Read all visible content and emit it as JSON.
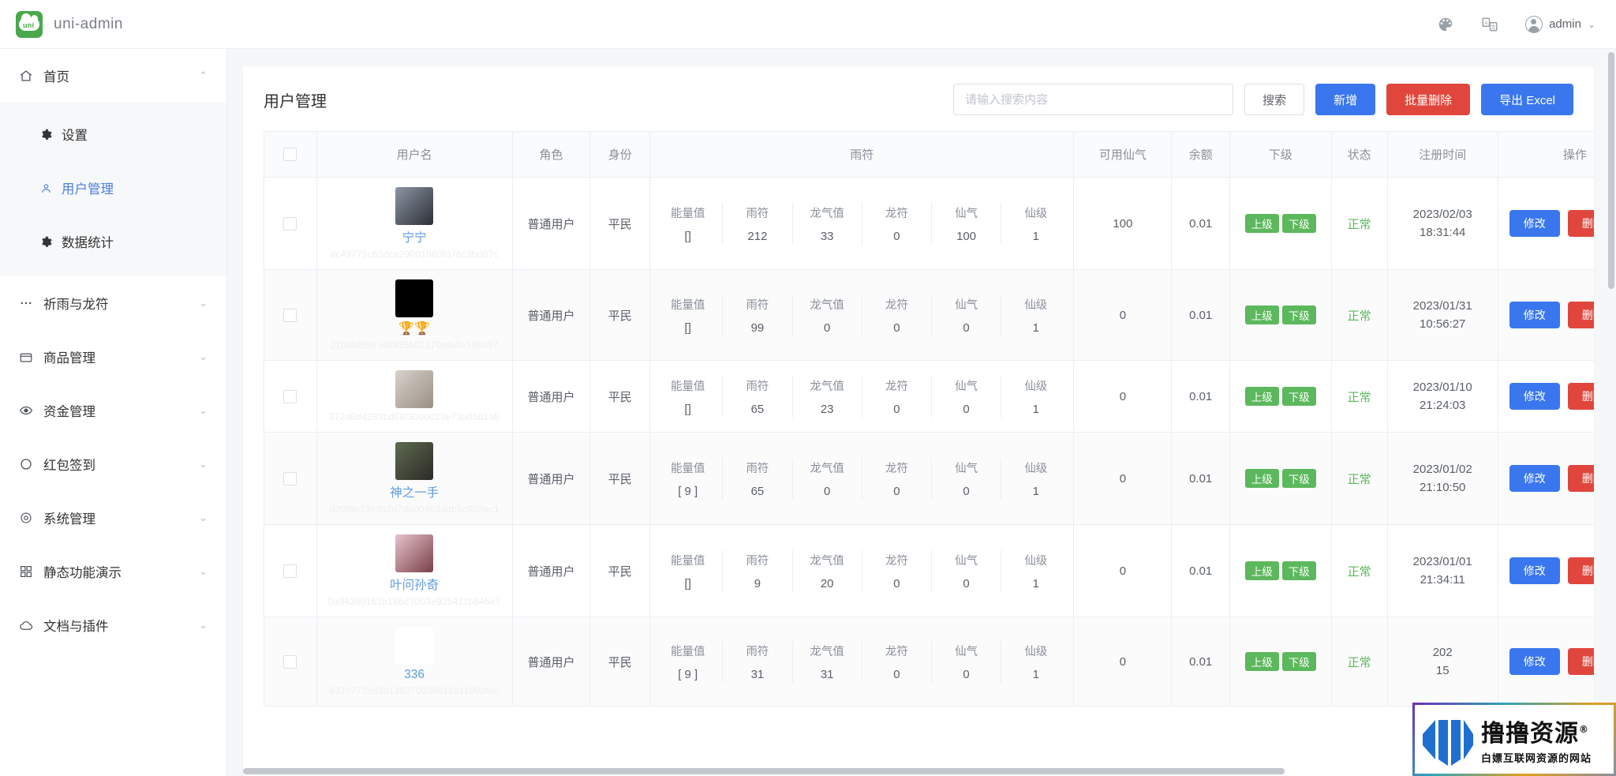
{
  "topbar": {
    "brand_mark": "uni",
    "brand_name": "uni-admin",
    "theme_icon": "palette-icon",
    "language_icon": "language-icon",
    "user_label": "admin",
    "caret": "⌄"
  },
  "sidebar": {
    "items": [
      {
        "label": "首页",
        "icon": "home-icon",
        "arrow": "⌃",
        "expanded": true,
        "children": [
          {
            "label": "设置",
            "icon": "gear-icon",
            "active": false
          },
          {
            "label": "用户管理",
            "icon": "user-icon",
            "active": true
          },
          {
            "label": "数据统计",
            "icon": "gear-icon",
            "active": false
          }
        ]
      },
      {
        "label": "祈雨与龙符",
        "icon": "dots-icon",
        "arrow": "⌄"
      },
      {
        "label": "商品管理",
        "icon": "shop-icon",
        "arrow": "⌄"
      },
      {
        "label": "资金管理",
        "icon": "eye-icon",
        "arrow": "⌄"
      },
      {
        "label": "红包签到",
        "icon": "circle-icon",
        "arrow": "⌄"
      },
      {
        "label": "系统管理",
        "icon": "settings-icon",
        "arrow": "⌄"
      },
      {
        "label": "静态功能演示",
        "icon": "grid-icon",
        "arrow": "⌄"
      },
      {
        "label": "文档与插件",
        "icon": "cloud-icon",
        "arrow": "⌄"
      }
    ]
  },
  "page": {
    "title": "用户管理",
    "search_placeholder": "请输入搜索内容",
    "search_value": "",
    "buttons": {
      "search": "搜索",
      "add": "新增",
      "batch_delete": "批量删除",
      "export": "导出 Excel"
    }
  },
  "table": {
    "columns": {
      "checkbox": "",
      "username": "用户名",
      "role": "角色",
      "identity": "身份",
      "rain": "雨符",
      "available_qi": "可用仙气",
      "balance": "余额",
      "sub": "下级",
      "state": "状态",
      "register_time": "注册时间",
      "action": "操作"
    },
    "rain_sub_columns": [
      "能量值",
      "雨符",
      "龙气值",
      "龙符",
      "仙气",
      "仙级"
    ],
    "row_buttons": {
      "edit": "修改",
      "delete": "删除"
    },
    "tags": {
      "up": "上级",
      "down": "下级"
    },
    "rows": [
      {
        "username": "宁宁",
        "uuid": "dc49771c63dce29001960fd76c3bd07c",
        "avatar_colors": [
          "#8d97a5",
          "#2b2e35"
        ],
        "role": "普通用户",
        "identity": "平民",
        "rain_values": [
          "[]",
          "212",
          "33",
          "0",
          "100",
          "1"
        ],
        "available_qi": "100",
        "balance": "0.01",
        "state": "正常",
        "register_time_date": "2023/02/03",
        "register_time_clock": "18:31:44"
      },
      {
        "username": "🏆🏆",
        "uuid": "21f8dd5b63d8835b01270efa0e196d97",
        "avatar_colors": [
          "#000000",
          "#000000"
        ],
        "role": "普通用户",
        "identity": "平民",
        "rain_values": [
          "[]",
          "99",
          "0",
          "0",
          "0",
          "1"
        ],
        "available_qi": "0",
        "balance": "0.01",
        "state": "正常",
        "register_time_date": "2023/01/31",
        "register_time_clock": "10:56:27"
      },
      {
        "username": "",
        "uuid": "372d8d4283bd66f3000023e73a05b1a8",
        "avatar_colors": [
          "#d8d2cb",
          "#9a8f84"
        ],
        "role": "普通用户",
        "identity": "平民",
        "rain_values": [
          "[]",
          "65",
          "23",
          "0",
          "0",
          "1"
        ],
        "available_qi": "0",
        "balance": "0.01",
        "state": "正常",
        "register_time_date": "2023/01/10",
        "register_time_clock": "21:24:03"
      },
      {
        "username": "神之一手",
        "uuid": "d26f8b7363b2d7da00403ddb5c6b3ec1",
        "avatar_colors": [
          "#5d6b4f",
          "#2d2a28"
        ],
        "role": "普通用户",
        "identity": "平民",
        "rain_values": [
          "[ 9 ]",
          "65",
          "0",
          "0",
          "0",
          "1"
        ],
        "available_qi": "0",
        "balance": "0.01",
        "state": "正常",
        "register_time_date": "2023/01/02",
        "register_time_clock": "21:10:50"
      },
      {
        "username": "叶问孙奇",
        "uuid": "0a94390163b18bd3003e925411b846e7",
        "avatar_colors": [
          "#e6c3cc",
          "#7a4048"
        ],
        "role": "普通用户",
        "identity": "平民",
        "rain_values": [
          "[]",
          "9",
          "20",
          "0",
          "0",
          "1"
        ],
        "available_qi": "0",
        "balance": "0.01",
        "state": "正常",
        "register_time_date": "2023/01/01",
        "register_time_clock": "21:34:11"
      },
      {
        "username": "336",
        "uuid": "637c772e63b138370039612d1190dfa0",
        "avatar_colors": [
          "#ffffff",
          "#ffffff"
        ],
        "role": "普通用户",
        "identity": "平民",
        "rain_values": [
          "[ 9 ]",
          "31",
          "31",
          "0",
          "0",
          "1"
        ],
        "available_qi": "0",
        "balance": "0.01",
        "state": "正常",
        "register_time_date": "202",
        "register_time_clock": "15"
      }
    ]
  },
  "watermark": {
    "main": "撸撸资源",
    "registered": "®",
    "sub": "白嫖互联网资源的网站"
  },
  "colors": {
    "primary": "#3a77ef",
    "danger": "#e1463c",
    "success": "#5cb85c",
    "brand_green": "#49a84c",
    "link_blue": "#5d9ce0"
  }
}
